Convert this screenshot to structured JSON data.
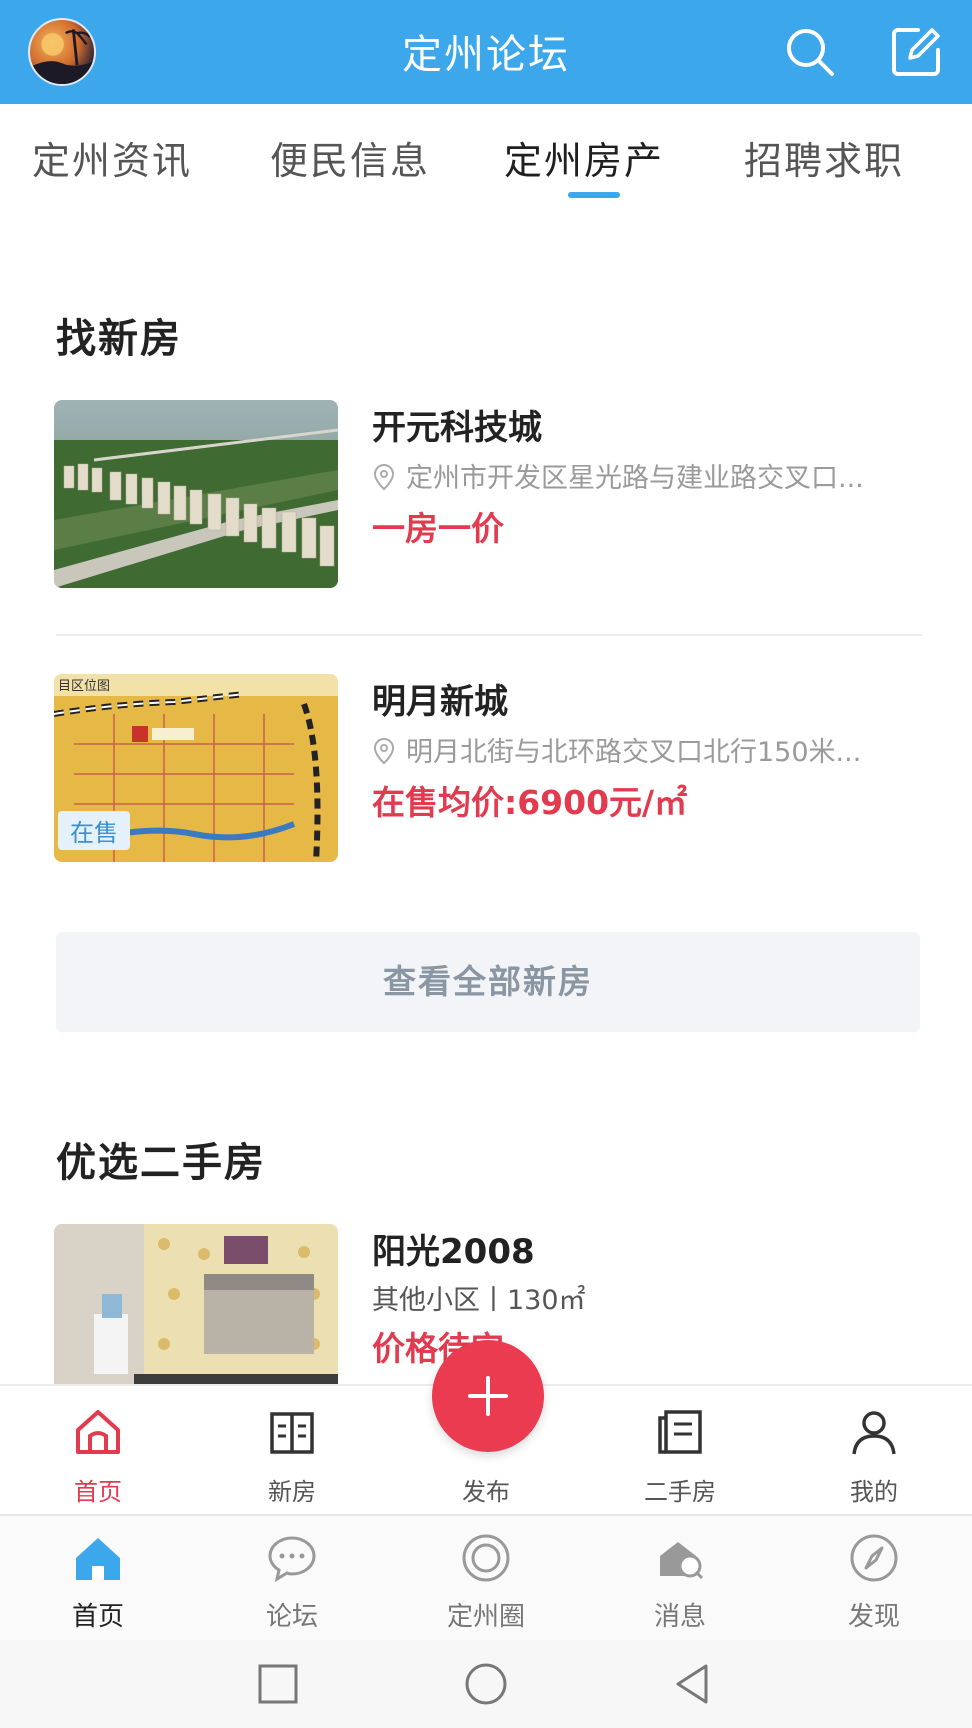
{
  "header": {
    "title": "定州论坛",
    "search_icon": "search-icon",
    "compose_icon": "compose-icon",
    "accent": "#3ca7ea"
  },
  "tabs": [
    {
      "label": "定州资讯",
      "active": false
    },
    {
      "label": "便民信息",
      "active": false
    },
    {
      "label": "定州房产",
      "active": true
    },
    {
      "label": "招聘求职",
      "active": false
    }
  ],
  "new_homes": {
    "title": "找新房",
    "items": [
      {
        "name": "开元科技城",
        "address": "定州市开发区星光路与建业路交叉口...",
        "price": "一房一价",
        "badge": ""
      },
      {
        "name": "明月新城",
        "address": "明月北街与北环路交叉口北行150米...",
        "price": "在售均价:6900元/㎡",
        "badge": "在售"
      }
    ],
    "view_all": "查看全部新房"
  },
  "second_hand": {
    "title": "优选二手房",
    "items": [
      {
        "name": "阳光2008",
        "meta": "其他小区丨130㎡",
        "price": "价格待定"
      }
    ]
  },
  "price_color": "#e23a4e",
  "nav_primary": {
    "items": [
      {
        "label": "首页",
        "icon": "home-outline-icon",
        "active": true
      },
      {
        "label": "新房",
        "icon": "building-icon",
        "active": false
      },
      {
        "label": "发布",
        "icon": "plus-icon",
        "active": false
      },
      {
        "label": "二手房",
        "icon": "book-icon",
        "active": false
      },
      {
        "label": "我的",
        "icon": "user-icon",
        "active": false
      }
    ]
  },
  "nav_secondary": {
    "items": [
      {
        "label": "首页",
        "icon": "home-icon",
        "active": true
      },
      {
        "label": "论坛",
        "icon": "chat-bubble-icon",
        "active": false
      },
      {
        "label": "定州圈",
        "icon": "ring-icon",
        "active": false
      },
      {
        "label": "消息",
        "icon": "message-icon",
        "active": false
      },
      {
        "label": "发现",
        "icon": "compass-icon",
        "active": false
      }
    ]
  }
}
